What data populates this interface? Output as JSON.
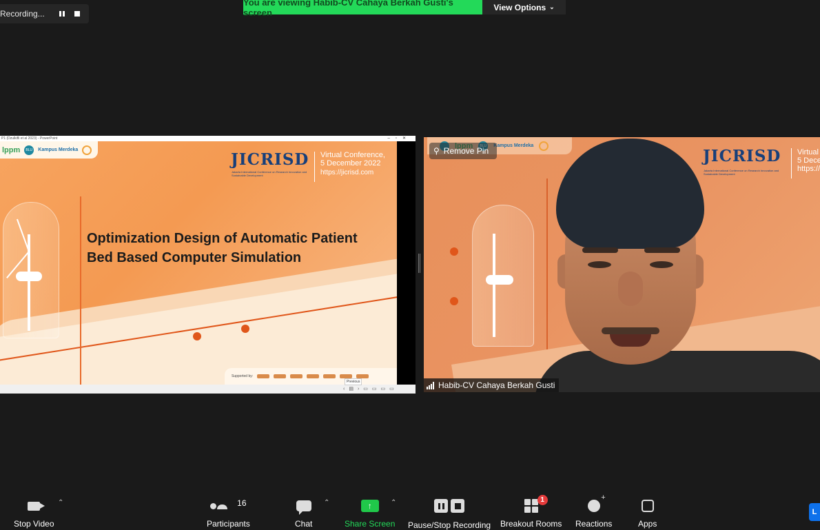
{
  "recording": {
    "label": "Recording..."
  },
  "banner": {
    "text": "You are viewing Habib-CV Cahaya Berkah Gusti's screen"
  },
  "view_options": {
    "label": "View Options"
  },
  "shared_screen": {
    "window_title": "P1 (Dzulkifli et al 2023) - PowerPoint",
    "slide": {
      "logos": [
        "lppm",
        "BLU",
        "Kampus Merdeka"
      ],
      "brand": "JICRISD",
      "brand_sub": "Jakarta International Conference on Research Innovation and Sustainable Development",
      "conference_line1": "Virtual Conference,",
      "conference_line2": "5 December 2022",
      "website": "https://jicrisd.com",
      "title_line1": "Optimization Design of Automatic Patient",
      "title_line2": "Bed Based Computer Simulation",
      "supported_by": "Supported by:"
    },
    "tooltip": "Previous"
  },
  "video": {
    "remove_pin": "Remove Pin",
    "participant_name": "Habib-CV Cahaya Berkah Gusti",
    "brand": "JICRISD",
    "brand_sub": "Jakarta International Conference on Research Innovation and Sustainable Development",
    "conference_line1": "Virtual",
    "conference_line2": "5 Dece",
    "website": "https://"
  },
  "toolbar": {
    "stop_video": "Stop Video",
    "participants": "Participants",
    "participants_count": "16",
    "chat": "Chat",
    "share_screen": "Share Screen",
    "pause_stop_recording": "Pause/Stop Recording",
    "breakout_rooms": "Breakout Rooms",
    "breakout_badge": "1",
    "reactions": "Reactions",
    "apps": "Apps",
    "edge_label": "L"
  },
  "colors": {
    "accent_green": "#23d959",
    "badge_red": "#e53b3b",
    "slide_orange": "#f49a52",
    "brand_blue": "#173f7a"
  }
}
